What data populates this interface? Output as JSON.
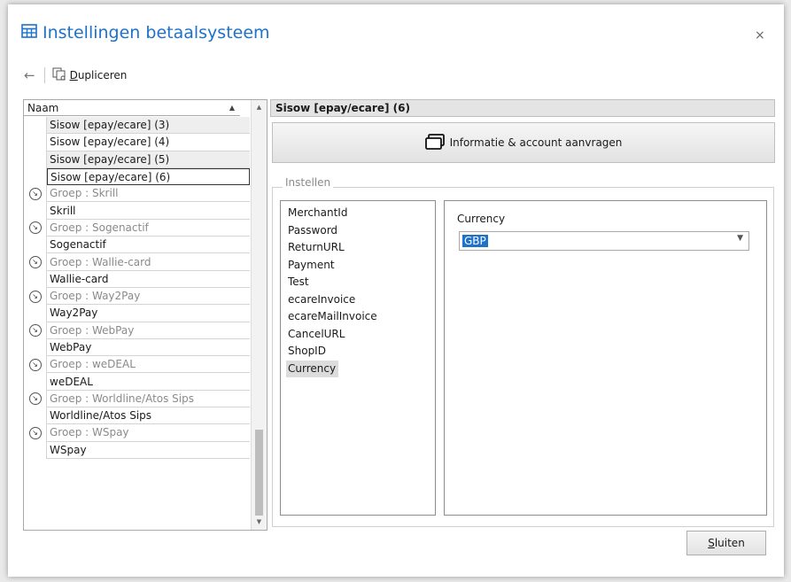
{
  "window": {
    "title": "Instellingen betaalsysteem",
    "close_glyph": "×"
  },
  "toolbar": {
    "back_glyph": "←",
    "duplicate_label": "Dupliceren"
  },
  "list": {
    "header": "Naam",
    "sort_glyph": "▲",
    "rows": [
      {
        "label": "Sisow [epay/ecare] (3)",
        "kind": "item-alt"
      },
      {
        "label": "Sisow [epay/ecare] (4)",
        "kind": "item"
      },
      {
        "label": "Sisow [epay/ecare] (5)",
        "kind": "item-alt"
      },
      {
        "label": "Sisow [epay/ecare] (6)",
        "kind": "selected"
      },
      {
        "label": "Groep : Skrill",
        "kind": "group"
      },
      {
        "label": "Skrill",
        "kind": "item"
      },
      {
        "label": "Groep : Sogenactif",
        "kind": "group"
      },
      {
        "label": "Sogenactif",
        "kind": "item"
      },
      {
        "label": "Groep : Wallie-card",
        "kind": "group"
      },
      {
        "label": "Wallie-card",
        "kind": "item"
      },
      {
        "label": "Groep : Way2Pay",
        "kind": "group"
      },
      {
        "label": "Way2Pay",
        "kind": "item"
      },
      {
        "label": "Groep : WebPay",
        "kind": "group"
      },
      {
        "label": "WebPay",
        "kind": "item"
      },
      {
        "label": "Groep : weDEAL",
        "kind": "group"
      },
      {
        "label": "weDEAL",
        "kind": "item"
      },
      {
        "label": "Groep : Worldline/Atos Sips",
        "kind": "group"
      },
      {
        "label": "Worldline/Atos Sips",
        "kind": "item"
      },
      {
        "label": "Groep : WSpay",
        "kind": "group"
      },
      {
        "label": "WSpay",
        "kind": "item"
      }
    ]
  },
  "detail": {
    "title": "Sisow [epay/ecare] (6)",
    "info_button": "Informatie & account aanvragen",
    "group_label": "Instellen",
    "params": [
      "MerchantId",
      "Password",
      "ReturnURL",
      "Payment",
      "Test",
      "ecareInvoice",
      "ecareMailInvoice",
      "CancelURL",
      "ShopID",
      "Currency"
    ],
    "selected_param": "Currency",
    "field_label": "Currency",
    "field_value": "GBP"
  },
  "footer": {
    "close_label": "Sluiten"
  },
  "colors": {
    "accent": "#1e72c9"
  }
}
